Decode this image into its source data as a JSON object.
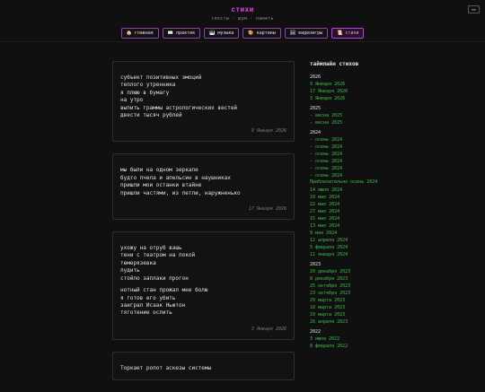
{
  "header": {
    "title": "стихи",
    "tagline": "тексты · шум · память",
    "corner_label": "≡≡",
    "icon_color": "#e040e0"
  },
  "nav": [
    {
      "icon": "🏠",
      "icon_name": "home-icon",
      "label": "главная"
    },
    {
      "icon": "📖",
      "icon_name": "book-icon",
      "label": "практик"
    },
    {
      "icon": "🎹",
      "icon_name": "piano-icon",
      "label": "музыка"
    },
    {
      "icon": "🎨",
      "icon_name": "palette-icon",
      "label": "картины"
    },
    {
      "icon": "🖼",
      "icon_name": "picture-icon",
      "label": "видеоигры"
    },
    {
      "icon": "📜",
      "icon_name": "scroll-icon",
      "label": "стихи",
      "active": true
    }
  ],
  "posts": [
    {
      "stanzas": [
        [
          "субъект позитивных эмоций",
          "теплого утренника",
          "я плюю в бумагу",
          "на утро",
          "выпить граммы астрологических вестей",
          "двести тысяч рублей"
        ]
      ],
      "date": "9 Января 2026"
    },
    {
      "stanzas": [
        [
          "мы были на одном зеркале",
          "будто пчела и апельсин в наушниках",
          "пришли мои останки втайне",
          "пришли частями, из петли, наружненько"
        ]
      ],
      "date": "17 Января 2026"
    },
    {
      "stanzas": [
        [
          "ухожу на отруб вашь",
          "тени с театром на покой",
          "темерязевка",
          "лудить",
          "стойло заплаки прогон"
        ],
        [
          "нотный стан прожал мне болю",
          "я готов его убить",
          "заиграл Исаак Ньютон",
          "тяготение ослить"
        ]
      ],
      "date": "3 Января 2026"
    },
    {
      "stanzas": [
        [
          "Торкает ропот аскезы системы"
        ]
      ],
      "date": ""
    }
  ],
  "sidebar": {
    "title": "таймлайн стихов",
    "groups": [
      {
        "year": "2026",
        "links": [
          "9 Января 2026",
          "17 Января 2026",
          "3 Января 2026"
        ]
      },
      {
        "year": "2025",
        "links": [
          "- весна 2025",
          "- весна 2025"
        ]
      },
      {
        "year": "2024",
        "links": [
          "- осень 2024",
          "- осень 2024",
          "- осень 2024",
          "- осень 2024",
          "- осень 2024",
          "- осень 2024",
          "Приблизительно осень 2024",
          "14 июля 2024",
          "10 мая 2024",
          "22 мая 2024",
          "27 мая 2024",
          "15 мая 2024",
          "13 мая 2024",
          "9 мая 2024",
          "12 апреля 2024",
          "5 февраля 2024",
          "11 января 2024"
        ]
      },
      {
        "year": "2023",
        "links": [
          "20 декабря 2023",
          "8 декабря 2023",
          "25 октября 2023",
          "23 октября 2023",
          "29 марта 2023",
          "18 марта 2023",
          "10 марта 2023",
          "26 апреля 2023"
        ]
      },
      {
        "year": "2022",
        "links": [
          "3 июля 2022",
          "8 февраля 2022"
        ]
      }
    ]
  }
}
